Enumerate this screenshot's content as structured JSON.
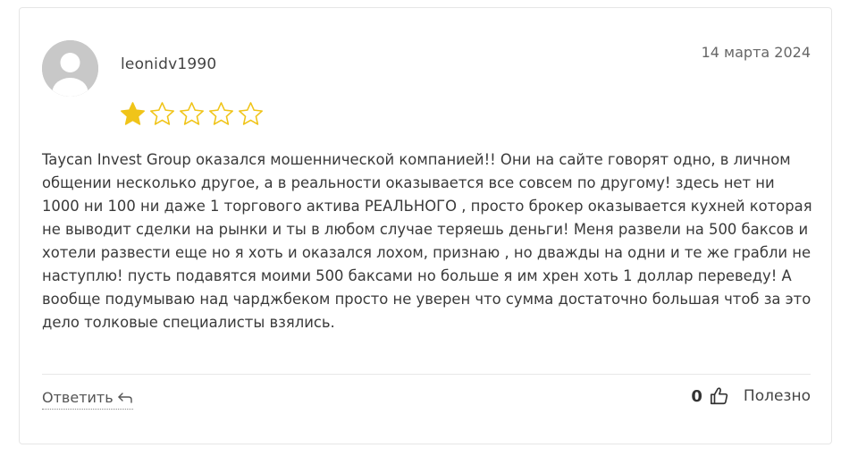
{
  "review": {
    "username": "leonidv1990",
    "date": "14 марта 2024",
    "rating": 1,
    "max_rating": 5,
    "text": "Taycan Invest Group оказался мошеннической компанией!! Они на сайте говорят одно, в личном общении несколько другое, а в реальности оказывается все совсем по другому! здесь нет ни 1000 ни 100 ни даже 1 торгового актива РЕАЛЬНОГО , просто брокер оказывается кухней которая не выводит сделки на рынки и ты в любом случае теряешь деньги! Меня развели на 500 баксов и хотели развести еще но я хоть и оказался лохом, признаю , но дважды на одни и те же грабли не наступлю! пусть подавятся моими 500 баксами но больше я им хрен хоть 1 доллар переведу! А вообще подумываю над чарджбеком просто не уверен что сумма достаточно большая чтоб за это дело толковые специалисты взялись.",
    "reply_label": "Ответить",
    "useful_count": "0",
    "useful_label": "Полезно"
  },
  "colors": {
    "star_filled": "#f0c419",
    "star_empty_stroke": "#f0c419",
    "avatar_bg": "#c8c8c8",
    "avatar_fg": "#ffffff"
  },
  "icons": {
    "avatar": "user-avatar-icon",
    "star": "star-icon",
    "reply": "reply-arrow-icon",
    "useful": "thumbs-up-icon"
  }
}
